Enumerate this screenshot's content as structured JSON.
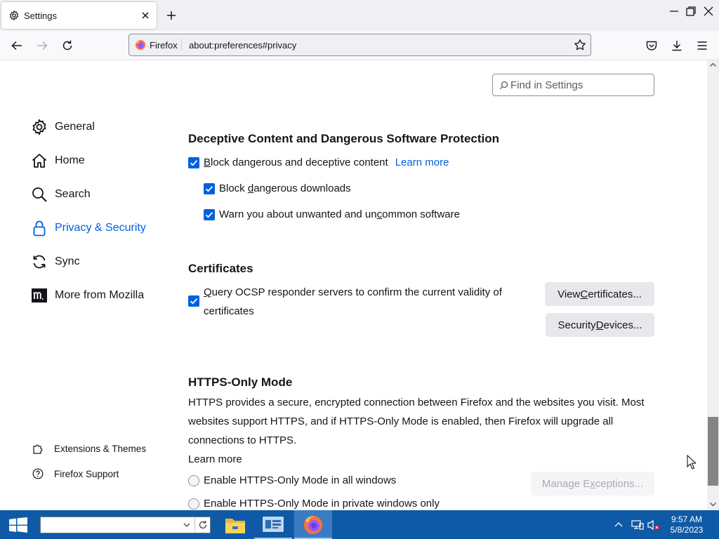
{
  "tab": {
    "title": "Settings"
  },
  "urlbar": {
    "identity": "Firefox",
    "url": "about:preferences#privacy"
  },
  "search": {
    "placeholder": "Find in Settings"
  },
  "sidebar": {
    "categories": [
      {
        "label": "General",
        "icon": "gear-icon"
      },
      {
        "label": "Home",
        "icon": "home-icon"
      },
      {
        "label": "Search",
        "icon": "search-icon"
      },
      {
        "label": "Privacy & Security",
        "icon": "lock-icon",
        "selected": true
      },
      {
        "label": "Sync",
        "icon": "sync-icon"
      },
      {
        "label": "More from Mozilla",
        "icon": "mozilla-icon"
      }
    ],
    "footer": [
      {
        "label": "Extensions & Themes",
        "icon": "puzzle-icon"
      },
      {
        "label": "Firefox Support",
        "icon": "help-icon"
      }
    ]
  },
  "deceptive": {
    "heading": "Deceptive Content and Dangerous Software Protection",
    "block_prefix": "B",
    "block_rest": "lock dangerous and deceptive content",
    "learn_more": "Learn more",
    "downloads_pre": "Block ",
    "downloads_key": "d",
    "downloads_post": "angerous downloads",
    "unwanted_pre": "Warn you about unwanted and un",
    "unwanted_key": "c",
    "unwanted_post": "ommon software"
  },
  "certificates": {
    "heading": "Certificates",
    "ocsp_pre": "",
    "ocsp_key": "Q",
    "ocsp_post": "uery OCSP responder servers to confirm the current validity of",
    "ocsp_line2": "certificates",
    "view_pre": "View ",
    "view_key": "C",
    "view_post": "ertificates...",
    "devices_pre": "Security ",
    "devices_key": "D",
    "devices_post": "evices..."
  },
  "https_only": {
    "heading": "HTTPS-Only Mode",
    "description": "HTTPS provides a secure, encrypted connection between Firefox and the websites you visit. Most websites support HTTPS, and if HTTPS-Only Mode is enabled, then Firefox will upgrade all connections to HTTPS.",
    "learn_more": "Learn more",
    "all_windows": "Enable HTTPS-Only Mode in all windows",
    "private_only": "Enable HTTPS-Only Mode in private windows only",
    "manage_pre": "Manage E",
    "manage_key": "x",
    "manage_post": "ceptions..."
  },
  "taskbar": {
    "time": "9:57 AM",
    "date": "5/8/2023"
  },
  "colors": {
    "accent": "#0061e0",
    "taskbar": "#0f5aa7"
  }
}
